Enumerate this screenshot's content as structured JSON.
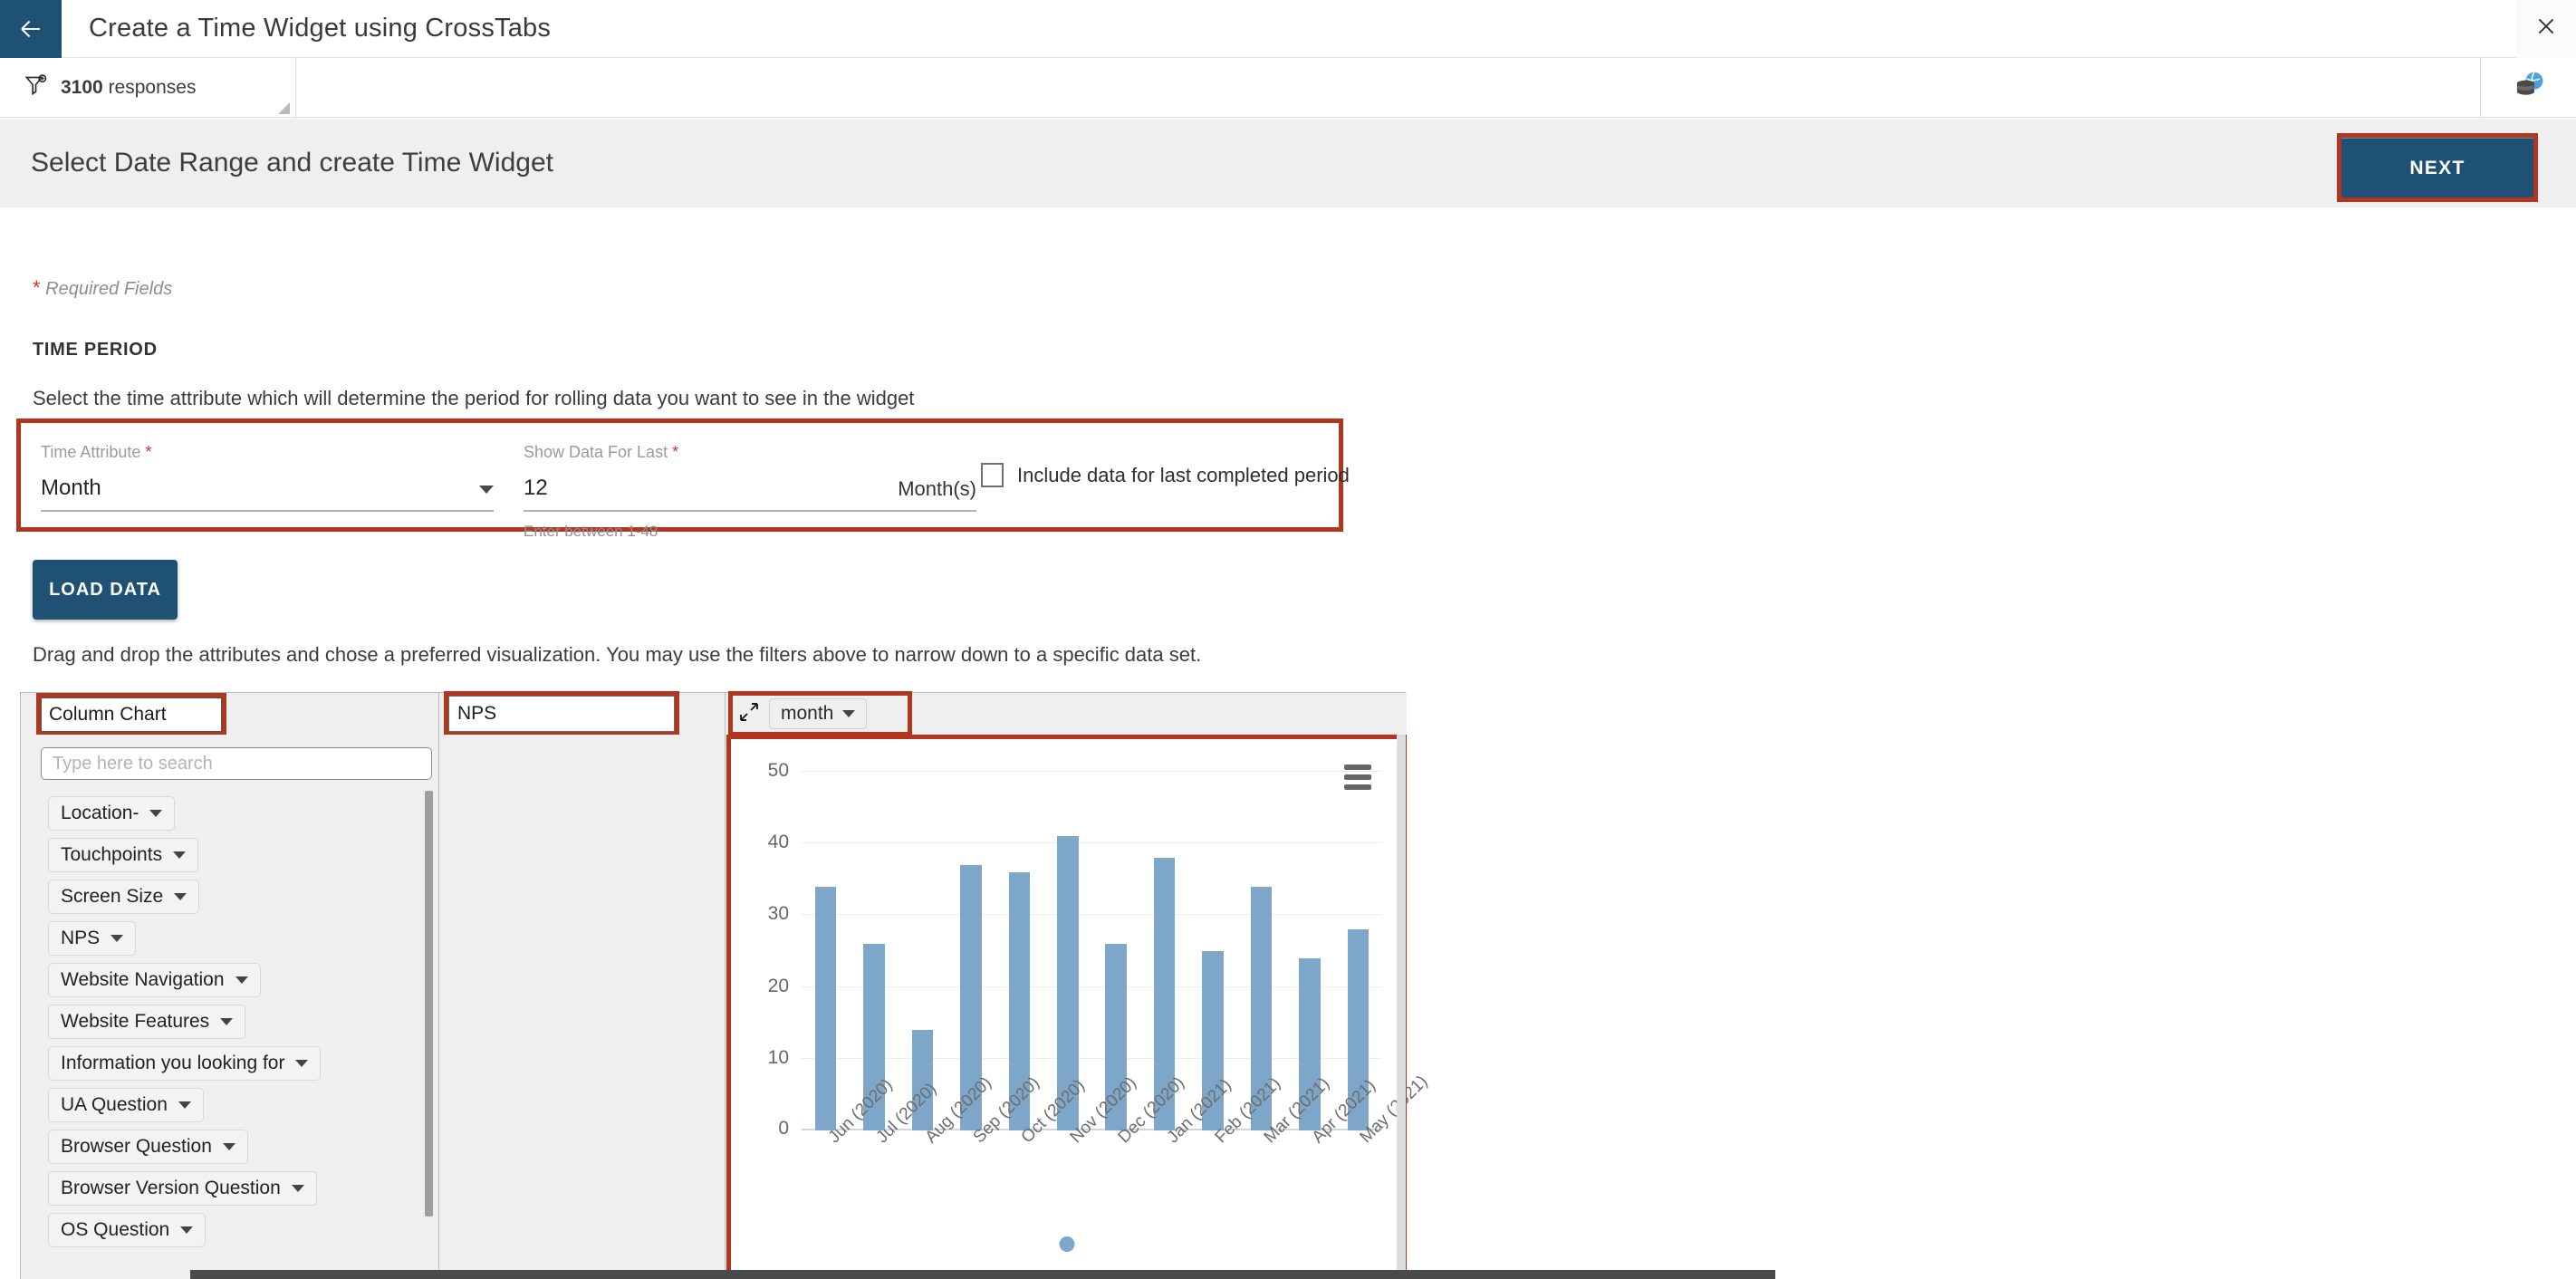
{
  "topbar": {
    "back_icon": "arrow-left-icon",
    "title": "Create a Time Widget using CrossTabs",
    "close_icon": "close-icon"
  },
  "filterbar": {
    "funnel_icon": "filter-add-icon",
    "responses_count": "3100",
    "responses_label": "responses",
    "database_icon": "database-globe-icon"
  },
  "section": {
    "title": "Select Date Range and create Time Widget",
    "next_label": "NEXT"
  },
  "body": {
    "required_note": "Required Fields",
    "time_period_label": "TIME PERIOD",
    "time_description": "Select the time attribute which will determine the period for rolling data you want to see in the widget",
    "load_data_label": "LOAD DATA",
    "drag_description": "Drag and drop the attributes and chose a preferred visualization. You may use the filters above to narrow down to a specific data set."
  },
  "form": {
    "time_attribute": {
      "label": "Time Attribute",
      "value": "Month",
      "caret_icon": "caret-down-icon"
    },
    "show_data_for_last": {
      "label": "Show Data For Last",
      "value": "12",
      "unit": "Month(s)",
      "hint": "Enter between 1-48"
    },
    "include_last_period": {
      "label": "Include data for last completed period",
      "checked": false
    }
  },
  "builder": {
    "viz_type": "Column Chart",
    "rows_field": "NPS",
    "columns_field": "month",
    "expand_icon": "expand-diagonal-icon",
    "chip_caret_icon": "caret-down-icon",
    "search_placeholder": "Type here to search",
    "attributes": [
      {
        "label": "Location-"
      },
      {
        "label": "Touchpoints"
      },
      {
        "label": "Screen Size"
      },
      {
        "label": "NPS"
      },
      {
        "label": "Website Navigation"
      },
      {
        "label": "Website Features"
      },
      {
        "label": "Information you looking for"
      },
      {
        "label": "UA Question"
      },
      {
        "label": "Browser Question"
      },
      {
        "label": "Browser Version Question"
      },
      {
        "label": "OS Question"
      }
    ],
    "chart_menu_icon": "hamburger-menu-icon"
  },
  "colors": {
    "brand_dark_blue": "#1e5173",
    "highlight_red": "#b0361f",
    "bar_blue": "#7da6c9",
    "required_star": "#d0342c",
    "section_bg": "#efefef"
  },
  "chart_data": {
    "type": "bar",
    "title": "",
    "xlabel": "",
    "ylabel": "",
    "ylim": [
      0,
      50
    ],
    "yticks": [
      0,
      10,
      20,
      30,
      40,
      50
    ],
    "grid": true,
    "legend": false,
    "categories": [
      "Jun (2020)",
      "Jul (2020)",
      "Aug (2020)",
      "Sep (2020)",
      "Oct (2020)",
      "Nov (2020)",
      "Dec (2020)",
      "Jan (2021)",
      "Feb (2021)",
      "Mar (2021)",
      "Apr (2021)",
      "May (2021)"
    ],
    "values": [
      34,
      26,
      14,
      37,
      36,
      41,
      26,
      38,
      25,
      34,
      24,
      28
    ],
    "series": [
      {
        "name": "NPS",
        "values": [
          34,
          26,
          14,
          37,
          36,
          41,
          26,
          38,
          25,
          34,
          24,
          28
        ]
      }
    ]
  }
}
